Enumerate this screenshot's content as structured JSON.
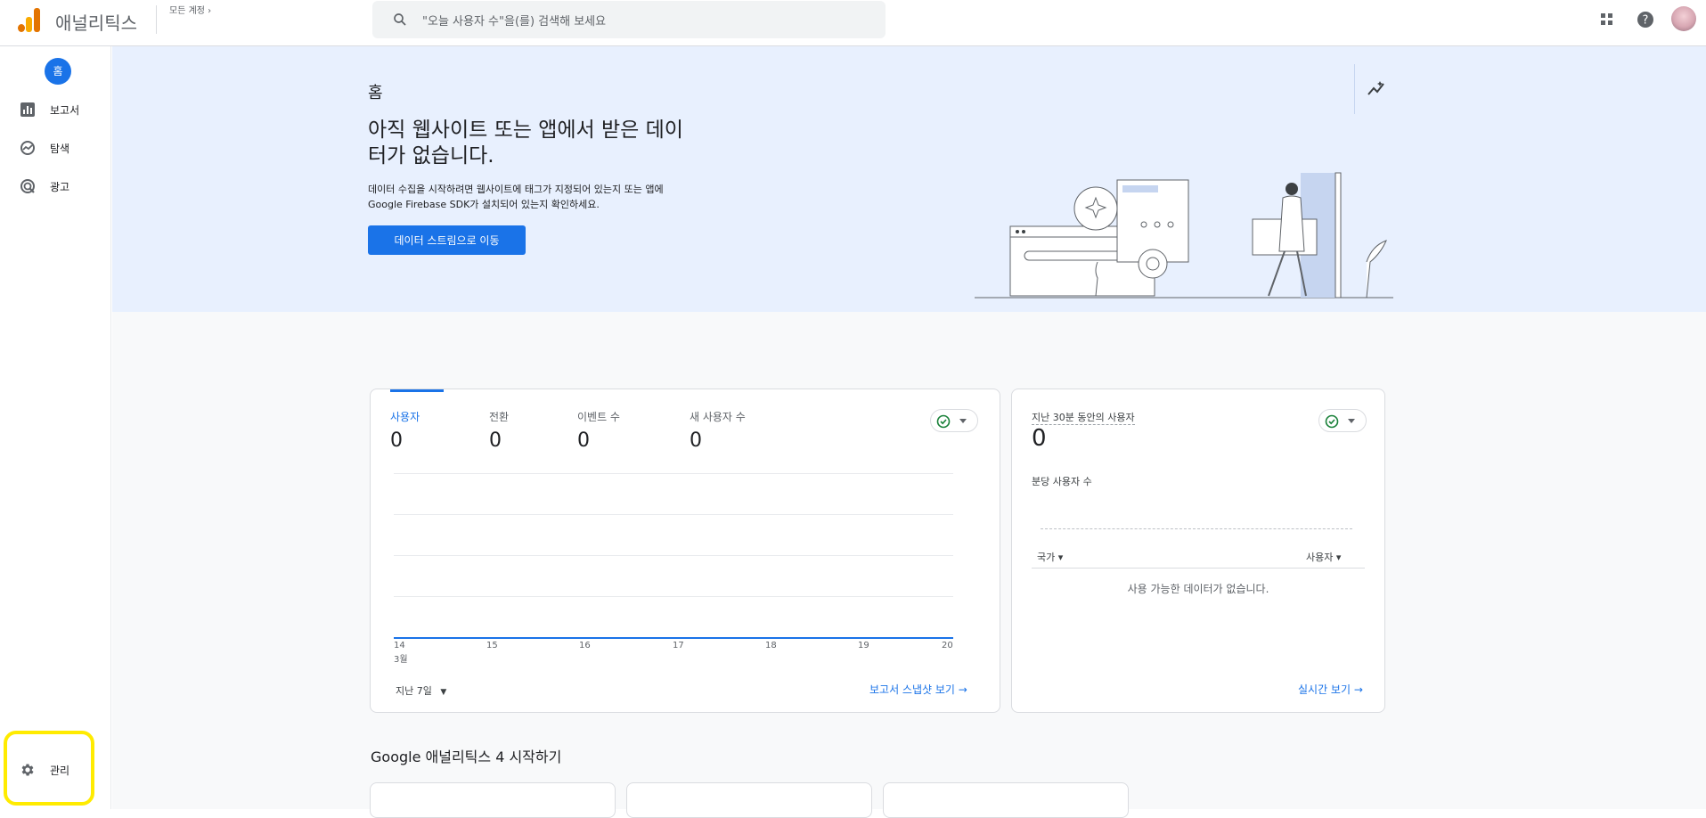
{
  "header": {
    "app_name": "애널리틱스",
    "account_label": "모든 계정 ›",
    "search_placeholder": "\"오늘 사용자 수\"을(를) 검색해 보세요",
    "icons": [
      "apps-grid-icon",
      "help-icon",
      "avatar"
    ]
  },
  "sidebar": {
    "home_label": "홈",
    "items": [
      {
        "label": "보고서",
        "icon": "bar-chart-icon"
      },
      {
        "label": "탐색",
        "icon": "explore-icon"
      },
      {
        "label": "광고",
        "icon": "ads-target-icon"
      }
    ],
    "admin_label": "관리",
    "admin_icon": "gear-icon"
  },
  "hero": {
    "title": "홈",
    "subtitle": "아직 웹사이트 또는 앱에서 받은 데이터가 없습니다.",
    "description": "데이터 수집을 시작하려면 웹사이트에 태그가 지정되어 있는지 또는 앱에 Google Firebase SDK가 설치되어 있는지 확인하세요.",
    "button_label": "데이터 스트림으로 이동"
  },
  "overview_card": {
    "metrics": [
      {
        "label": "사용자",
        "value": "0"
      },
      {
        "label": "전환",
        "value": "0"
      },
      {
        "label": "이벤트 수",
        "value": "0"
      },
      {
        "label": "새 사용자 수",
        "value": "0"
      }
    ],
    "x_ticks": [
      "14",
      "15",
      "16",
      "17",
      "18",
      "19",
      "20"
    ],
    "x_month": "3월",
    "date_range": "지난 7일",
    "link_label": "보고서 스냅샷 보기 →"
  },
  "realtime_card": {
    "title": "지난 30분 동안의 사용자",
    "value": "0",
    "per_minute_label": "분당 사용자 수",
    "col_country": "국가 ▾",
    "col_users": "사용자 ▾",
    "empty_text": "사용 가능한 데이터가 없습니다.",
    "link_label": "실시간 보기 →"
  },
  "getting_started": {
    "title": "Google 애널리틱스 4 시작하기"
  },
  "colors": {
    "accent": "#1a73e8",
    "hero_bg": "#e8f0fe",
    "highlight": "#ffeb00",
    "logo_orange": "#f9ab00",
    "logo_dark_orange": "#e37400"
  }
}
